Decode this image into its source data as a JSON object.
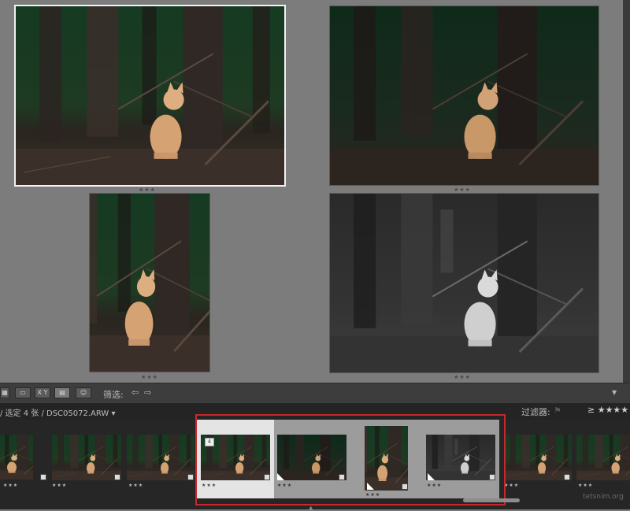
{
  "toolbar": {
    "filter_label": "筛选:",
    "prev_icon": "arrow-left-icon",
    "next_icon": "arrow-right-icon",
    "view_buttons": [
      "grid-view",
      "loupe-view",
      "compare-view",
      "survey-view",
      "people-view"
    ],
    "compare_label": "X Y"
  },
  "filmstrip": {
    "breadcrumb": "/ 选定 4 张 / DSC05072.ARW ▾",
    "filter_label": "过滤器:",
    "thumb_index_badge": "4",
    "watermark": "tetsnim.org"
  },
  "survey": {
    "stars": "★★★"
  },
  "colors": {
    "selection_border": "#c8282d",
    "survey_bg": "#7c7c7c"
  }
}
